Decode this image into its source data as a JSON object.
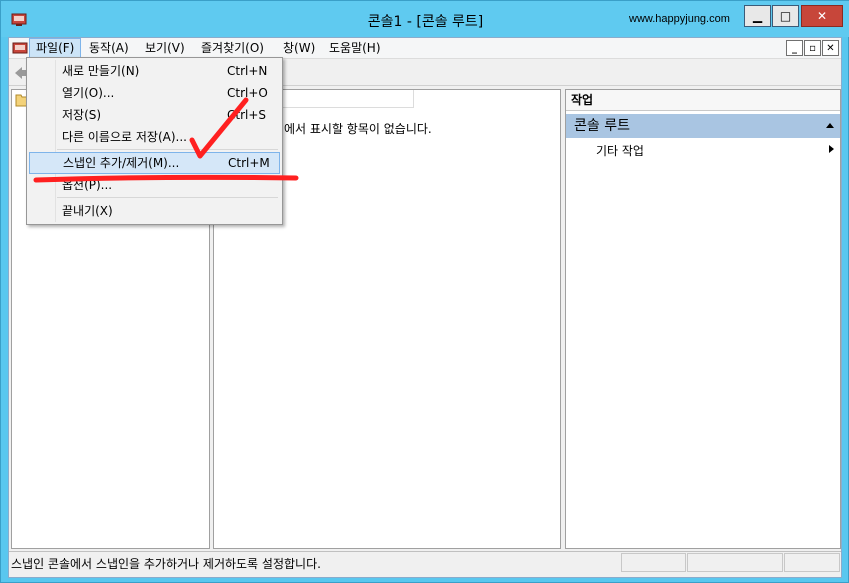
{
  "window": {
    "title": "콘솔1 - [콘솔 루트]",
    "watermark": "www.happyjung.com",
    "minimize_label": "▁",
    "maximize_label": "□",
    "close_label": "✕",
    "icons": [
      "console-icon"
    ]
  },
  "menubar": {
    "items": [
      {
        "label": "파일(F)",
        "active": true
      },
      {
        "label": "동작(A)"
      },
      {
        "label": "보기(V)"
      },
      {
        "label": "즐겨찾기(O)"
      },
      {
        "label": "창(W)"
      },
      {
        "label": "도움말(H)"
      }
    ],
    "mdi_minimize": "_",
    "mdi_restore": "▫",
    "mdi_close": "✕"
  },
  "file_menu": {
    "items": [
      {
        "label": "새로 만들기(N)",
        "shortcut": "Ctrl+N"
      },
      {
        "label": "열기(O)...",
        "shortcut": "Ctrl+O"
      },
      {
        "label": "저장(S)",
        "shortcut": "Ctrl+S"
      },
      {
        "label": "다른 이름으로 저장(A)...",
        "shortcut": ""
      },
      {
        "label": "스냅인 추가/제거(M)...",
        "shortcut": "Ctrl+M",
        "highlighted": true
      },
      {
        "label": "옵션(P)...",
        "shortcut": ""
      },
      {
        "label": "끝내기(X)",
        "shortcut": ""
      }
    ]
  },
  "center": {
    "empty_message": "현재 보기에서 표시할 항목이 없습니다."
  },
  "actions": {
    "title": "작업",
    "group": "콘솔 루트",
    "items": [
      "기타 작업"
    ]
  },
  "status": {
    "text": "스냅인 콘솔에서 스냅인을 추가하거나 제거하도록 설정합니다."
  },
  "colors": {
    "titlebar": "#5fcaf0",
    "highlight": "#d5e7f8",
    "annotation": "#ff2020",
    "action_group": "#a9c5e2"
  }
}
